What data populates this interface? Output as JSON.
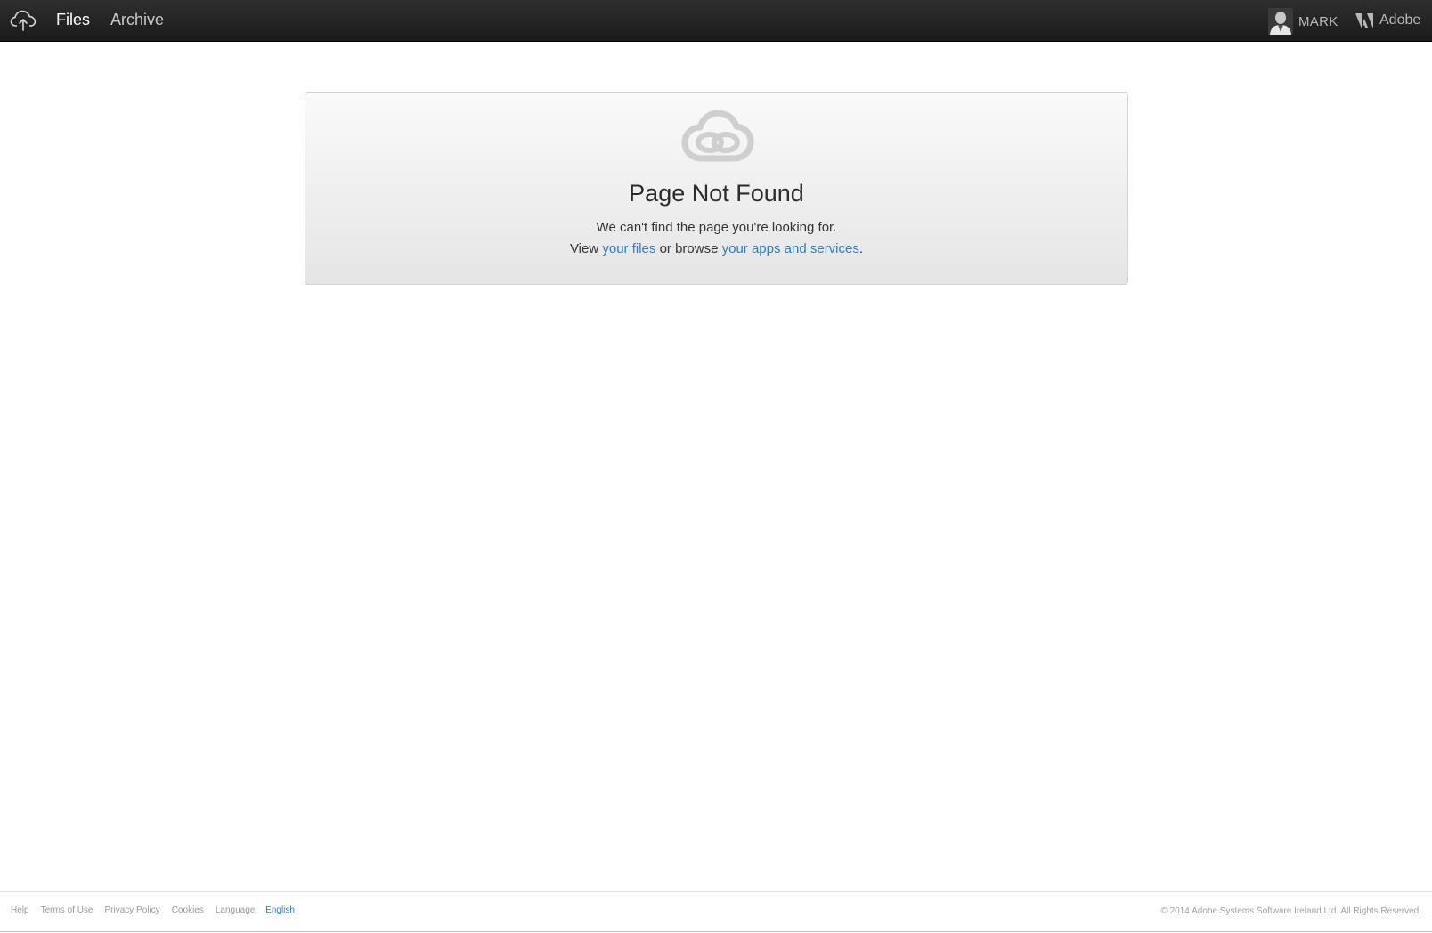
{
  "nav": {
    "files_label": "Files",
    "archive_label": "Archive",
    "user_name": "MARK",
    "adobe_label": "Adobe",
    "icons": {
      "upload": "cloud-upload-icon",
      "adobe": "adobe-logo-icon",
      "avatar": "user-avatar"
    }
  },
  "error": {
    "title": "Page Not Found",
    "message": "We can't find the page you're looking for.",
    "view_prefix": "View",
    "files_link": "your files",
    "browse_text": "or browse",
    "apps_link": "your apps and services",
    "period": ".",
    "icon": "creative-cloud-logo-icon"
  },
  "footer": {
    "help": "Help",
    "terms": "Terms of Use",
    "privacy": "Privacy Policy",
    "cookies": "Cookies",
    "language_label": "Language:",
    "language_value": "English",
    "copyright": "© 2014 Adobe Systems Software Ireland Ltd. All Rights Reserved."
  },
  "colors": {
    "topbar": "#222222",
    "link": "#2d7ec2",
    "card_bg": "#ececec"
  }
}
